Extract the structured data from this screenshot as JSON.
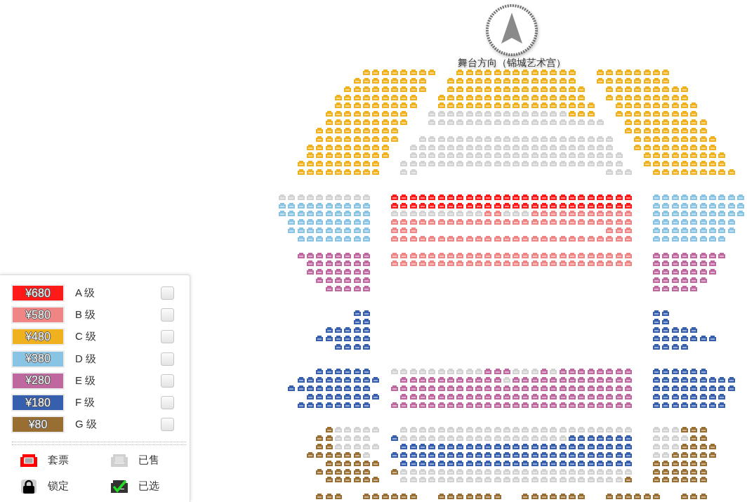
{
  "seat_map": {
    "stage_label": "舞台方向（锦城艺术宫）",
    "rows": [
      {
        "color": "#efb11e",
        "sold": [
          false,
          false,
          false,
          false,
          false,
          false,
          false,
          false
        ]
      },
      {
        "color": "#efb11e",
        "sold": [
          false,
          false,
          false,
          false,
          false,
          false,
          false,
          false,
          false,
          false,
          false,
          false,
          false
        ]
      },
      {
        "color": "#efb11e",
        "sold": [
          false,
          false,
          false,
          false,
          false,
          false,
          false,
          false
        ]
      },
      {
        "color": "#efb11e",
        "sold": [
          false,
          false,
          false,
          false,
          false,
          false,
          false,
          false
        ]
      },
      {
        "color": "#efb11e",
        "sold": [
          false,
          false,
          false,
          false,
          false,
          false,
          false,
          false,
          false,
          false,
          false,
          false,
          false,
          false
        ]
      },
      {
        "color": "#efb11e",
        "sold": [
          false,
          false,
          false,
          false,
          false,
          false,
          false,
          false
        ]
      },
      {
        "color": "#efb11e",
        "sold": [
          false,
          false,
          false,
          false,
          false,
          false,
          false,
          false,
          false
        ]
      },
      {
        "color": "#efb11e",
        "sold": [
          false,
          false,
          false,
          false,
          false,
          false,
          false,
          false,
          false,
          false,
          false,
          false,
          false,
          false,
          false
        ]
      },
      {
        "color": "#efb11e",
        "sold": [
          false,
          false,
          false,
          false,
          false,
          false,
          false,
          false,
          false
        ]
      },
      {
        "color": "#efb11e",
        "sold": [
          false,
          false,
          false,
          false,
          false,
          false,
          false,
          false,
          false
        ]
      },
      {
        "color": "#efb11e",
        "sold": [
          false,
          false,
          false,
          false,
          false,
          false,
          false,
          false,
          false,
          false,
          false,
          false,
          false,
          false,
          false,
          false
        ]
      },
      {
        "color": "#efb11e",
        "sold": [
          false,
          false,
          false,
          false,
          false,
          false,
          false,
          false,
          false
        ]
      },
      {
        "color": "#efb11e",
        "sold": [
          false,
          false,
          false,
          false,
          false,
          false,
          false,
          false,
          false
        ]
      },
      {
        "color": "#efb11e",
        "sold": [
          false,
          false,
          false,
          false,
          false,
          false,
          false,
          false,
          false,
          false,
          false,
          false,
          false,
          false,
          false,
          false,
          false
        ]
      },
      {
        "color": "#efb11e",
        "sold": [
          false,
          false,
          false,
          false,
          false,
          false,
          false,
          false,
          false
        ]
      },
      {
        "color": "#efb11e",
        "sold": [
          false,
          false,
          false,
          false,
          false,
          false,
          false,
          false,
          false
        ]
      },
      {
        "color": "#efb11e",
        "sold": [
          true,
          true,
          true,
          true,
          true,
          true,
          true,
          true,
          true,
          true,
          true,
          true,
          true,
          true,
          true,
          false,
          false,
          false
        ]
      },
      {
        "color": "#efb11e",
        "sold": [
          false,
          false,
          false,
          false,
          false,
          false,
          false,
          false,
          false
        ]
      },
      {
        "color": "#efb11e",
        "sold": [
          false,
          false,
          false,
          false,
          false,
          false,
          false,
          false,
          false
        ]
      },
      {
        "sold": [
          true,
          true,
          true,
          true,
          true,
          true,
          true,
          true,
          true,
          true,
          true,
          true,
          true,
          true,
          true,
          true,
          true,
          true,
          true
        ]
      },
      {
        "color": "#efb11e",
        "sold": [
          false,
          false,
          false,
          false,
          false,
          false,
          false,
          false,
          false
        ]
      },
      {
        "color": "#efb11e",
        "sold": [
          false,
          false,
          false,
          false,
          false,
          false,
          false,
          false,
          false
        ]
      },
      {
        "color": "#efb11e",
        "sold": [
          false,
          false,
          false,
          false,
          false,
          false,
          false,
          false,
          false
        ]
      },
      {
        "color": "#efb11e",
        "sold": [
          false,
          false,
          false,
          false,
          false,
          false,
          false,
          false,
          false
        ]
      },
      {
        "sold": [
          true,
          true,
          true,
          true,
          true,
          true,
          true,
          true,
          true,
          true,
          true,
          true,
          true,
          true,
          true,
          true,
          true,
          true,
          true,
          true,
          true
        ]
      },
      {
        "color": "#efb11e",
        "sold": [
          false,
          false,
          false,
          false,
          false,
          false,
          false,
          false,
          false
        ]
      },
      {
        "color": "#efb11e",
        "sold": [
          false,
          false,
          false,
          false,
          false,
          false,
          false,
          false,
          false
        ]
      },
      {
        "sold": [
          true,
          true,
          true,
          true,
          true,
          true,
          true,
          true,
          true,
          true,
          true,
          true,
          true,
          true,
          true,
          true,
          true,
          true,
          true,
          true,
          true,
          true
        ]
      },
      {
        "color": "#efb11e",
        "sold": [
          false,
          false,
          false,
          false,
          false,
          false,
          false,
          false,
          false
        ]
      },
      {
        "color": "#efb11e",
        "sold": [
          false,
          false,
          false,
          false,
          false,
          false,
          false,
          false,
          false
        ]
      },
      {
        "sold": [
          true,
          true,
          true,
          true,
          true,
          true,
          true,
          true,
          true,
          true,
          true,
          true,
          true,
          true,
          true,
          true,
          true,
          true,
          true,
          true,
          true,
          true,
          true
        ]
      },
      {
        "color": "#efb11e",
        "sold": [
          false,
          false,
          false,
          false,
          false,
          false,
          false,
          false,
          false
        ]
      },
      {
        "color": "#efb11e",
        "sold": [
          false,
          false,
          false,
          false,
          false,
          false,
          false,
          false,
          false
        ]
      },
      {
        "sold": [
          true,
          true,
          true,
          true,
          true,
          true,
          true,
          true,
          true,
          true,
          true,
          true,
          true,
          true,
          true,
          true,
          true,
          true,
          true,
          true,
          true,
          true,
          true,
          true
        ]
      },
      {
        "color": "#efb11e",
        "sold": [
          false,
          false,
          false,
          false,
          false,
          false,
          false,
          false,
          false
        ]
      },
      {
        "color": "#efb11e",
        "sold": [
          false,
          false,
          false,
          false,
          false,
          false,
          false,
          false,
          false
        ]
      },
      {
        "sold": [
          true,
          true
        ]
      },
      {
        "sold": [
          true,
          true,
          true
        ]
      },
      {
        "color": "#efb11e",
        "sold": [
          false,
          false,
          false,
          false,
          false,
          false,
          false,
          false,
          false
        ]
      },
      {
        "sold": [
          true,
          true,
          true,
          true,
          true,
          true,
          true,
          true,
          true,
          true
        ]
      },
      {
        "color": "#ff1a1a",
        "sold": [
          false,
          false,
          false,
          false,
          false,
          false,
          false,
          false,
          false,
          false,
          false,
          false,
          false,
          false,
          false,
          false,
          false,
          false,
          false,
          false,
          false,
          false,
          false,
          false,
          false,
          false
        ]
      },
      {
        "color": "#89c4e4",
        "sold": [
          false,
          false,
          false,
          false,
          false,
          false,
          false,
          false,
          false,
          false
        ]
      },
      {
        "color": "#89c4e4",
        "sold": [
          false,
          false,
          false,
          false,
          false,
          false,
          false,
          false,
          false,
          false
        ]
      },
      {
        "color": "#ff1a1a",
        "sold": [
          false,
          false,
          false,
          false,
          false,
          false,
          false,
          false,
          false,
          false,
          false,
          false,
          false,
          false,
          false,
          false,
          false,
          false,
          false,
          false,
          false,
          false,
          false,
          false,
          false,
          false
        ]
      },
      {
        "color": "#89c4e4",
        "sold": [
          false,
          false,
          false,
          false,
          false,
          false,
          false,
          false,
          false,
          false
        ]
      },
      {
        "color": "#89c4e4",
        "sold": [
          false,
          false,
          false,
          false,
          false,
          false,
          false,
          false,
          false,
          false
        ]
      },
      {
        "color": "#ef8585",
        "sold": [
          true,
          true,
          true,
          true,
          true,
          true,
          true,
          true,
          true,
          true,
          false,
          false,
          true,
          true,
          true,
          false,
          false,
          false,
          false,
          false,
          false,
          false,
          false,
          false,
          false,
          false
        ]
      },
      {
        "color": "#89c4e4",
        "sold": [
          false,
          false,
          false,
          false,
          false,
          false,
          false,
          false,
          false,
          false
        ]
      },
      {
        "color": "#89c4e4",
        "sold": [
          false,
          false,
          false,
          false,
          false,
          false,
          false,
          false,
          false
        ]
      },
      {
        "color": "#ef8585",
        "sold": [
          false,
          false,
          false,
          false,
          false,
          false,
          false,
          false,
          false,
          false,
          false,
          false,
          false,
          false,
          false,
          false,
          false,
          false,
          false,
          false,
          false,
          false,
          false,
          false,
          false,
          false
        ]
      },
      {
        "color": "#89c4e4",
        "sold": [
          false,
          false,
          false,
          false,
          false,
          false,
          false,
          false,
          false
        ]
      },
      {
        "color": "#89c4e4",
        "sold": [
          false,
          false,
          false,
          false,
          false,
          false,
          false,
          false,
          false
        ]
      },
      {
        "color": "#ef8585",
        "sold": [
          false,
          false,
          false
        ]
      },
      {
        "color": "#ef8585",
        "sold": [
          false,
          false,
          false
        ]
      },
      {
        "color": "#89c4e4",
        "sold": [
          false,
          false,
          false,
          false,
          false,
          false,
          false,
          false,
          false
        ]
      },
      {
        "color": "#89c4e4",
        "sold": [
          false,
          false,
          false,
          false,
          false,
          false,
          false,
          false
        ]
      },
      {
        "color": "#ef8585",
        "sold": [
          false,
          false,
          false,
          false,
          false,
          false,
          false,
          false,
          false,
          false,
          false,
          false,
          false,
          false,
          false,
          false,
          false,
          false,
          false,
          false,
          false,
          false,
          false,
          false,
          false,
          false
        ]
      },
      {
        "color": "#89c4e4",
        "sold": [
          false,
          false,
          false,
          false,
          false,
          false,
          false,
          false
        ]
      },
      {
        "color": "#bf68a0",
        "sold": [
          false,
          false,
          false,
          false,
          false,
          false,
          false,
          false
        ]
      },
      {
        "color": "#ef8585",
        "sold": [
          false,
          false,
          false,
          false,
          false,
          false,
          false,
          false,
          false,
          false,
          false,
          false,
          false,
          false,
          false,
          false,
          false,
          false,
          false,
          false,
          false,
          false,
          false,
          false,
          false,
          false
        ]
      },
      {
        "color": "#bf68a0",
        "sold": [
          false,
          false,
          false,
          false,
          false,
          false,
          false,
          false
        ]
      },
      {
        "color": "#bf68a0",
        "sold": [
          false,
          false,
          false,
          false,
          false,
          false,
          false
        ]
      },
      {
        "color": "#ef8585",
        "sold": [
          false,
          false,
          false,
          false,
          false,
          false,
          false,
          false,
          false,
          false,
          false,
          false,
          false,
          false,
          false,
          false,
          false,
          false,
          false,
          false,
          false,
          false,
          false,
          false,
          false,
          false
        ]
      },
      {
        "color": "#bf68a0",
        "sold": [
          false,
          false,
          false,
          false,
          false,
          false,
          false
        ]
      },
      {
        "color": "#bf68a0",
        "sold": [
          false,
          false,
          false,
          false,
          false,
          false,
          false
        ]
      },
      {
        "color": "#bf68a0",
        "sold": [
          false,
          false,
          false,
          false,
          false,
          false,
          false
        ]
      },
      {
        "color": "#bf68a0",
        "sold": [
          false,
          false,
          false,
          false,
          false,
          false
        ]
      },
      {
        "color": "#bf68a0",
        "sold": [
          false,
          false,
          false,
          false,
          false,
          false
        ]
      },
      {
        "color": "#bf68a0",
        "sold": [
          false,
          false,
          false,
          false,
          false
        ]
      },
      {
        "color": "#bf68a0",
        "sold": [
          false,
          false,
          false,
          false,
          false
        ]
      },
      {
        "color": "#365fae",
        "sold": [
          false,
          false
        ]
      },
      {
        "color": "#365fae",
        "sold": [
          false,
          false
        ]
      },
      {
        "color": "#365fae",
        "sold": [
          false,
          false
        ]
      },
      {
        "color": "#365fae",
        "sold": [
          false,
          false
        ]
      },
      {
        "color": "#365fae",
        "sold": [
          false,
          false,
          false,
          false,
          false
        ]
      },
      {
        "color": "#365fae",
        "sold": [
          false,
          false,
          false,
          false,
          false
        ]
      },
      {
        "color": "#365fae",
        "sold": [
          false,
          false,
          false,
          false,
          false,
          false
        ]
      },
      {
        "color": "#365fae",
        "sold": [
          false,
          false,
          false,
          false,
          false,
          false,
          false
        ]
      },
      {
        "color": "#365fae",
        "sold": [
          false,
          false,
          false,
          false
        ]
      },
      {
        "color": "#365fae",
        "sold": [
          false,
          false,
          false,
          false
        ]
      },
      {
        "color": "#365fae",
        "sold": [
          false,
          false,
          false,
          false,
          false,
          false
        ]
      },
      {
        "color": "#bf68a0",
        "sold": [
          true,
          true,
          true,
          true,
          true,
          true,
          true,
          true,
          true,
          true,
          false,
          false,
          false,
          true,
          true,
          true,
          false,
          true,
          false,
          false,
          false,
          false,
          false,
          false,
          false,
          false
        ]
      },
      {
        "color": "#365fae",
        "sold": [
          false,
          false,
          false,
          false,
          false,
          false
        ]
      },
      {
        "color": "#365fae",
        "sold": [
          false,
          false,
          false,
          false,
          false,
          false,
          false,
          false,
          false
        ]
      },
      {
        "color": "#bf68a0",
        "sold": [
          false,
          false,
          false,
          false,
          false,
          false,
          false,
          false,
          false,
          false,
          false,
          true,
          false,
          false,
          false,
          false,
          false,
          false,
          false,
          false,
          false,
          false,
          false,
          false,
          false
        ]
      },
      {
        "color": "#365fae",
        "sold": [
          false,
          false,
          false,
          false,
          false,
          false,
          false,
          false,
          false
        ]
      },
      {
        "color": "#365fae",
        "sold": [
          false,
          false,
          false,
          false,
          false,
          false,
          false,
          false,
          false
        ]
      },
      {
        "color": "#bf68a0",
        "sold": [
          false,
          false,
          false,
          false,
          false,
          false,
          false,
          false,
          false,
          false,
          false,
          false,
          false,
          false,
          false,
          false,
          false,
          false,
          false,
          false,
          false,
          false,
          false,
          false,
          false,
          false
        ]
      },
      {
        "color": "#365fae",
        "sold": [
          false,
          false,
          false,
          false,
          false,
          false,
          false,
          false,
          false
        ]
      },
      {
        "color": "#365fae",
        "sold": [
          false,
          false,
          false,
          false,
          false,
          false,
          false,
          false
        ]
      },
      {
        "color": "#bf68a0",
        "sold": [
          false,
          false,
          false,
          false,
          false,
          false,
          false,
          false,
          false,
          false,
          false,
          false,
          false,
          false,
          false,
          false,
          false,
          false,
          false,
          false,
          false,
          false,
          false,
          false,
          false
        ]
      },
      {
        "color": "#365fae",
        "sold": [
          false,
          false,
          false,
          false,
          false,
          false,
          false,
          false
        ]
      },
      {
        "color": "#365fae",
        "sold": [
          false,
          false,
          false,
          false,
          false,
          false,
          false,
          false
        ]
      },
      {
        "color": "#bf68a0",
        "sold": [
          false,
          false,
          false,
          false,
          false,
          false,
          false,
          false,
          false,
          false,
          false,
          false,
          false,
          false,
          false,
          false,
          false,
          false,
          false,
          false,
          false,
          false,
          false,
          false,
          false,
          false
        ]
      },
      {
        "color": "#365fae",
        "sold": [
          false,
          false,
          false,
          false,
          false,
          false,
          false,
          false
        ]
      },
      {
        "color": "#986e32",
        "sold": [
          false,
          true,
          true,
          true,
          true,
          true
        ]
      },
      {
        "sold": [
          true,
          true,
          true,
          true,
          true,
          true,
          true,
          true,
          true,
          true,
          true,
          true,
          true,
          true,
          true,
          true,
          true,
          true,
          true,
          true,
          true,
          true,
          true,
          true,
          true
        ]
      },
      {
        "color": "#986e32",
        "sold": [
          true,
          true,
          true,
          false,
          false,
          false
        ]
      },
      {
        "color": "#986e32",
        "sold": [
          false,
          false,
          true,
          true,
          true,
          true
        ]
      },
      {
        "color": "#365fae",
        "sold": [
          false,
          true,
          true,
          true,
          true,
          true,
          true,
          true,
          true,
          true,
          true,
          true,
          true,
          true,
          true,
          true,
          true,
          true,
          true,
          false,
          false,
          false,
          false,
          false,
          false,
          false
        ]
      },
      {
        "color": "#986e32",
        "sold": [
          true,
          true,
          true,
          true,
          false,
          false
        ]
      },
      {
        "color": "#986e32",
        "sold": [
          false,
          false,
          true,
          true,
          true,
          true,
          true
        ]
      },
      {
        "color": "#365fae",
        "sold": [
          false,
          false,
          false,
          false,
          false,
          false,
          false,
          false,
          false,
          false,
          false,
          false,
          false,
          false,
          false,
          false,
          false,
          false,
          false,
          false,
          false,
          false,
          false,
          false,
          false
        ]
      },
      {
        "color": "#986e32",
        "sold": [
          true,
          true,
          true,
          false,
          false,
          false,
          false
        ]
      },
      {
        "color": "#986e32",
        "sold": [
          false,
          false,
          false,
          false,
          false,
          false,
          true
        ]
      },
      {
        "color": "#365fae",
        "sold": [
          false,
          false,
          false,
          false,
          false,
          false,
          false,
          false,
          false,
          false,
          false,
          false,
          false,
          false,
          false,
          false,
          false,
          false,
          false,
          false,
          false,
          false,
          false,
          false,
          false,
          false
        ]
      },
      {
        "color": "#986e32",
        "sold": [
          true,
          true,
          false,
          false,
          false,
          false,
          false
        ]
      },
      {
        "color": "#986e32",
        "sold": [
          false,
          false,
          false,
          false,
          false,
          false
        ]
      },
      {
        "color": "#365fae",
        "sold": [
          false,
          false,
          false,
          false,
          false,
          false,
          false,
          false,
          false,
          false,
          false,
          false,
          false,
          false,
          false,
          false,
          false,
          false,
          false,
          false,
          false,
          false,
          false,
          false,
          false
        ]
      },
      {
        "color": "#986e32",
        "sold": [
          false,
          false,
          false,
          false,
          false,
          false
        ]
      },
      {
        "color": "#986e32",
        "sold": [
          false,
          false,
          false,
          false,
          false,
          false
        ]
      },
      {
        "color": "#986e32",
        "sold": [
          false,
          true,
          true,
          true,
          true,
          true,
          true,
          true,
          true,
          true,
          true,
          true,
          true,
          true,
          true,
          true,
          true,
          true,
          true,
          true,
          true,
          true,
          true,
          true,
          true,
          true
        ]
      },
      {
        "color": "#986e32",
        "sold": [
          false,
          false,
          false,
          false,
          false,
          false
        ]
      },
      {
        "color": "#986e32",
        "sold": [
          false,
          false,
          false,
          false,
          false,
          false
        ]
      },
      {
        "color": "#986e32",
        "sold": [
          true,
          true,
          true,
          true,
          true,
          true,
          true,
          true,
          true,
          true,
          true,
          true,
          true,
          true,
          true,
          true,
          true,
          true,
          true,
          true,
          true,
          true,
          true,
          true,
          false
        ]
      },
      {
        "color": "#986e32",
        "sold": [
          false,
          false,
          false,
          false,
          false,
          false
        ]
      },
      {
        "color": "#986e32",
        "sold": [
          false,
          false,
          false
        ]
      },
      {
        "color": "#986e32",
        "sold": [
          false,
          false,
          false,
          false,
          false,
          false
        ]
      },
      {
        "color": "#986e32",
        "sold": [
          false,
          false,
          false,
          false,
          false,
          false,
          false
        ]
      },
      {
        "color": "#986e32",
        "sold": [
          false,
          false,
          false,
          false,
          false,
          false,
          false
        ]
      },
      {
        "color": "#986e32",
        "sold": [
          false,
          false,
          false,
          false,
          false,
          false
        ]
      },
      {
        "color": "#986e32",
        "sold": [
          false,
          false,
          false
        ]
      }
    ]
  },
  "price_levels": [
    {
      "price": "¥680",
      "label": "A 级",
      "color": "#ff1a1a",
      "checked": false
    },
    {
      "price": "¥580",
      "label": "B 级",
      "color": "#ef8585",
      "checked": false
    },
    {
      "price": "¥480",
      "label": "C 级",
      "color": "#efb11e",
      "checked": false
    },
    {
      "price": "¥380",
      "label": "D 级",
      "color": "#89c4e4",
      "checked": false
    },
    {
      "price": "¥280",
      "label": "E 级",
      "color": "#bf68a0",
      "checked": false
    },
    {
      "price": "¥180",
      "label": "F 级",
      "color": "#365fae",
      "checked": false
    },
    {
      "price": "¥80",
      "label": "G 级",
      "color": "#986e32",
      "checked": false
    }
  ],
  "seat_states": [
    {
      "kind": "package",
      "label": "套票"
    },
    {
      "kind": "sold",
      "label": "已售"
    },
    {
      "kind": "locked",
      "label": "锁定"
    },
    {
      "kind": "selected",
      "label": "已选"
    }
  ]
}
